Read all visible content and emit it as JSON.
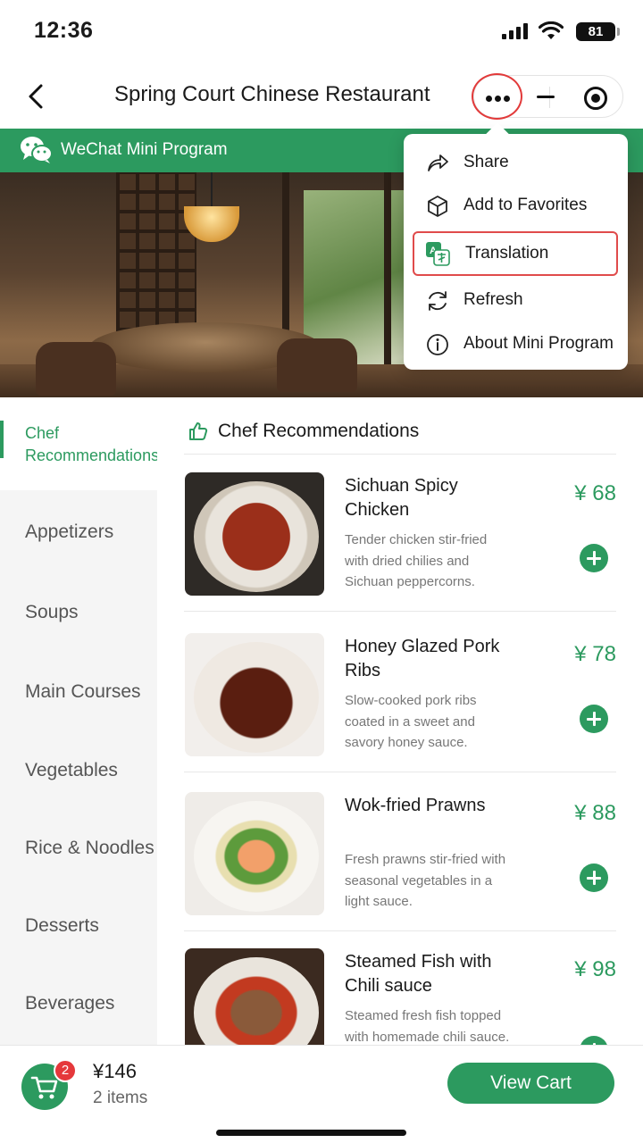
{
  "status_bar": {
    "time": "12:36",
    "battery": "81"
  },
  "nav": {
    "title": "Spring Court Chinese Restaurant"
  },
  "banner": {
    "label": "WeChat Mini Program"
  },
  "menu": {
    "items": [
      {
        "label": "Share",
        "icon": "share-icon"
      },
      {
        "label": "Add to Favorites",
        "icon": "cube-icon"
      },
      {
        "label": "Translation",
        "icon": "translate-icon"
      },
      {
        "label": "Refresh",
        "icon": "refresh-icon"
      },
      {
        "label": "About Mini Program",
        "icon": "info-icon"
      }
    ]
  },
  "sidebar": {
    "items": [
      {
        "label": "Chef\nRecommendations"
      },
      {
        "label": "Appetizers"
      },
      {
        "label": "Soups"
      },
      {
        "label": "Main Courses"
      },
      {
        "label": "Vegetables"
      },
      {
        "label": "Rice & Noodles"
      },
      {
        "label": "Desserts"
      },
      {
        "label": "Beverages"
      }
    ]
  },
  "section": {
    "title": "Chef Recommendations"
  },
  "dishes": [
    {
      "name": "Sichuan Spicy Chicken",
      "desc": "Tender chicken stir-fried with dried chilies and Sichuan peppercorns.",
      "price": "¥ 68"
    },
    {
      "name": "Honey Glazed Pork Ribs",
      "desc": "Slow-cooked pork ribs coated in a sweet and savory honey sauce.",
      "price": "¥ 78"
    },
    {
      "name": "Wok-fried Prawns",
      "desc": "Fresh prawns stir-fried with seasonal vegetables in a light sauce.",
      "price": "¥ 88"
    },
    {
      "name": "Steamed Fish with Chili sauce",
      "desc": "Steamed fresh fish topped with homemade chili sauce.",
      "price": "¥ 98"
    }
  ],
  "cart": {
    "badge": "2",
    "total": "¥146",
    "count": "2 items",
    "button": "View Cart"
  },
  "colors": {
    "accent": "#2c9a5f",
    "highlight": "#e04b4b",
    "badge": "#e5383b"
  }
}
